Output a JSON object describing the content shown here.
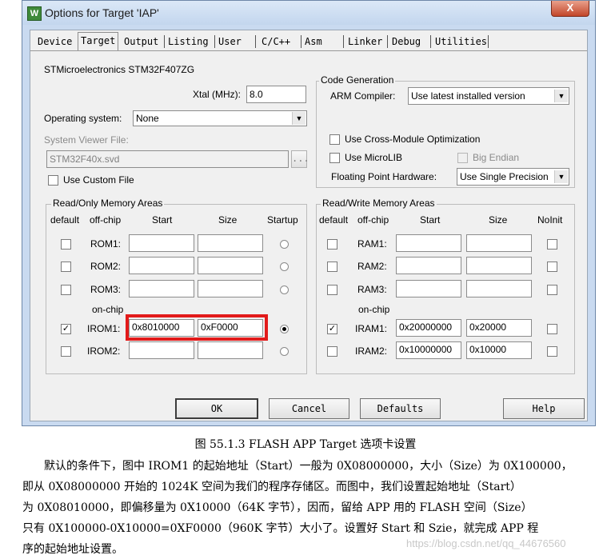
{
  "window": {
    "title": "Options for Target 'IAP'",
    "icon_glyph": "W",
    "close_glyph": "X"
  },
  "tabs": [
    "Device",
    "Target",
    "Output",
    "Listing",
    "User",
    "C/C++",
    "Asm",
    "Linker",
    "Debug",
    "Utilities"
  ],
  "active_tab": "Target",
  "target": {
    "device": "STMicroelectronics STM32F407ZG",
    "xtal_label": "Xtal (MHz):",
    "xtal_value": "8.0",
    "os_label": "Operating system:",
    "os_value": "None",
    "svd_label": "System Viewer File:",
    "svd_value": "STM32F40x.svd",
    "browse": "...",
    "custom_file_label": "Use Custom File",
    "codegen_title": "Code Generation",
    "arm_compiler_label": "ARM Compiler:",
    "arm_compiler_value": "Use latest installed version",
    "cross_module_label": "Use Cross-Module Optimization",
    "microlib_label": "Use MicroLIB",
    "big_endian_label": "Big Endian",
    "fpu_label": "Floating Point Hardware:",
    "fpu_value": "Use Single Precision"
  },
  "rom": {
    "title": "Read/Only Memory Areas",
    "headers": {
      "default": "default",
      "offchip": "off-chip",
      "start": "Start",
      "size": "Size",
      "startup": "Startup"
    },
    "onchip_label": "on-chip",
    "rows": [
      {
        "name": "ROM1:",
        "start": "",
        "size": "",
        "default": false,
        "startup": false
      },
      {
        "name": "ROM2:",
        "start": "",
        "size": "",
        "default": false,
        "startup": false
      },
      {
        "name": "ROM3:",
        "start": "",
        "size": "",
        "default": false,
        "startup": false
      },
      {
        "name": "IROM1:",
        "start": "0x8010000",
        "size": "0xF0000",
        "default": true,
        "startup": true
      },
      {
        "name": "IROM2:",
        "start": "",
        "size": "",
        "default": false,
        "startup": false
      }
    ]
  },
  "ram": {
    "title": "Read/Write Memory Areas",
    "headers": {
      "default": "default",
      "offchip": "off-chip",
      "start": "Start",
      "size": "Size",
      "noinit": "NoInit"
    },
    "onchip_label": "on-chip",
    "rows": [
      {
        "name": "RAM1:",
        "start": "",
        "size": "",
        "default": false,
        "noinit": false
      },
      {
        "name": "RAM2:",
        "start": "",
        "size": "",
        "default": false,
        "noinit": false
      },
      {
        "name": "RAM3:",
        "start": "",
        "size": "",
        "default": false,
        "noinit": false
      },
      {
        "name": "IRAM1:",
        "start": "0x20000000",
        "size": "0x20000",
        "default": true,
        "noinit": false
      },
      {
        "name": "IRAM2:",
        "start": "0x10000000",
        "size": "0x10000",
        "default": false,
        "noinit": false
      }
    ]
  },
  "buttons": {
    "ok": "OK",
    "cancel": "Cancel",
    "defaults": "Defaults",
    "help": "Help"
  },
  "highlight_color": "#e21a1a",
  "check_glyph": "✓",
  "doc": {
    "caption": "图 55.1.3 FLASH APP Target 选项卡设置",
    "lines": [
      "默认的条件下，图中 IROM1 的起始地址（Start）一般为 0X08000000，大小（Size）为 0X100000，",
      "即从 0X08000000 开始的 1024K 空间为我们的程序存储区。而图中，我们设置起始地址（Start）",
      "为 0X08010000，即偏移量为 0X10000（64K 字节），因而，留给 APP 用的 FLASH 空间（Size）",
      "只有 0X100000-0X10000=0XF0000（960K 字节）大小了。设置好 Start 和 Szie，就完成 APP 程",
      "序的起始地址设置。"
    ],
    "watermark": "https://blog.csdn.net/qq_44676560"
  }
}
